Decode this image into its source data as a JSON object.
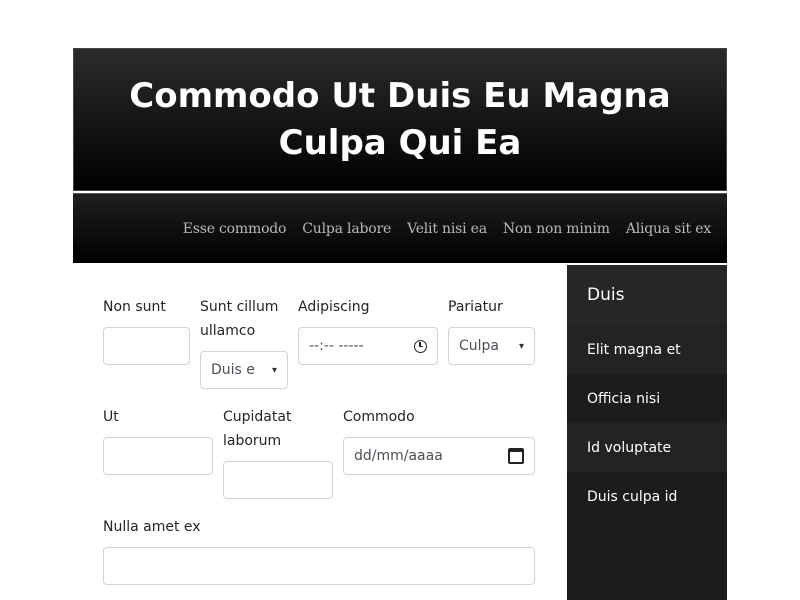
{
  "header": {
    "title": "Commodo Ut Duis Eu Magna Culpa Qui Ea"
  },
  "nav": {
    "links": [
      "Esse commodo",
      "Culpa labore",
      "Velit nisi ea",
      "Non non minim",
      "Aliqua sit ex"
    ]
  },
  "form": {
    "non_sunt": {
      "label": "Non sunt",
      "value": ""
    },
    "sunt_cillum": {
      "label": "Sunt cillum ullamco",
      "value": "Duis e"
    },
    "adipiscing": {
      "label": "Adipiscing",
      "value": "--:-- -----"
    },
    "pariatur": {
      "label": "Pariatur",
      "value": "Culpa"
    },
    "ut": {
      "label": "Ut",
      "value": ""
    },
    "cupidatat": {
      "label": "Cupidatat laborum",
      "value": ""
    },
    "commodo": {
      "label": "Commodo",
      "value": "dd/mm/aaaa"
    },
    "nulla": {
      "label": "Nulla amet ex",
      "value": ""
    }
  },
  "sidebar": {
    "title": "Duis",
    "items": [
      "Elit magna et",
      "Officia nisi",
      "Id voluptate",
      "Duis culpa id"
    ]
  }
}
